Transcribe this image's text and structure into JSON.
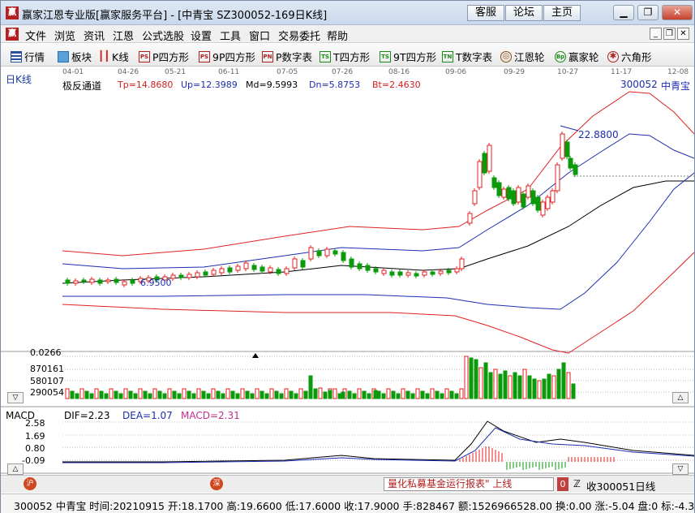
{
  "window": {
    "title": "赢家江恩专业版[赢家服务平台] - [中青宝  SZ300052-169日K线]",
    "logo": "赢",
    "links": [
      "客服",
      "论坛",
      "主页"
    ]
  },
  "menu": {
    "logo": "赢",
    "items": [
      "文件",
      "浏览",
      "资讯",
      "江恩",
      "公式选股",
      "设置",
      "工具",
      "窗口",
      "交易委托",
      "帮助"
    ]
  },
  "toolbar": {
    "items": [
      {
        "label": "行情",
        "icon": "grid-icon",
        "glyph": ""
      },
      {
        "label": "板块",
        "icon": "blocks-icon",
        "glyph": ""
      },
      {
        "label": "K线",
        "icon": "candlestick-icon",
        "glyph": ""
      },
      {
        "label": "P四方形",
        "icon": "ps-icon",
        "glyph": "PS"
      },
      {
        "label": "9P四方形",
        "icon": "ps9-icon",
        "glyph": "PS"
      },
      {
        "label": "P数字表",
        "icon": "pn-icon",
        "glyph": "PN"
      },
      {
        "label": "T四方形",
        "icon": "ts-icon",
        "glyph": "TS"
      },
      {
        "label": "9T四方形",
        "icon": "ts9-icon",
        "glyph": "TS"
      },
      {
        "label": "T数字表",
        "icon": "tn-icon",
        "glyph": "TN"
      },
      {
        "label": "江恩轮",
        "icon": "gann-wheel-icon",
        "glyph": "◎"
      },
      {
        "label": "赢家轮",
        "icon": "winner-wheel-icon",
        "glyph": "Bp"
      },
      {
        "label": "六角形",
        "icon": "hexagon-icon",
        "glyph": "✱"
      }
    ]
  },
  "chart": {
    "period_label": "日K线",
    "dates": [
      "04-01",
      "04-26",
      "05-21",
      "06-11",
      "07-05",
      "07-26",
      "08-16",
      "09-06",
      "09-29",
      "10-27",
      "11-17",
      "12-08"
    ],
    "indicator_name": "极反通道",
    "tp": "Tp=14.8680",
    "up": "Up=12.3989",
    "md": "Md=9.5993",
    "dn": "Dn=5.8753",
    "bt": "Bt=2.4630",
    "stock_code": "300052",
    "stock_name": "中青宝",
    "high_marker": "22.8800",
    "low_marker": "6.9500",
    "volume_labels": [
      "0.0266",
      "870161",
      "580107",
      "290054"
    ],
    "macd_name": "MACD",
    "dif": "DIF=2.23",
    "dea": "DEA=1.07",
    "macd": "MACD=2.31",
    "macd_labels": [
      "2.58",
      "1.69",
      "0.80",
      "-0.09"
    ],
    "colors": {
      "up": "#e02020",
      "down": "#0a9a0a",
      "tp": "#e02020",
      "mid": "#000000",
      "up_band": "#1c2eb0",
      "macd_dif": "#000000",
      "macd_dea": "#1c2eb0",
      "macd_bar": "#c0308c"
    }
  },
  "bottombar": {
    "left_icon": "沪",
    "mid_icon": "深",
    "marquee": "量化私募基金运行报表\" 上线",
    "marquee_icon": "0",
    "right_text": "收300051日线",
    "right_prefix": "ℤ"
  },
  "status": {
    "text": "300052 中青宝 时间:20210915 开:18.1700 高:19.6600 低:17.6000 收:17.9000 手:828467 额:1526966528.00 换:0.00 涨:-5.04 盘:0 标:-4.3092"
  }
}
